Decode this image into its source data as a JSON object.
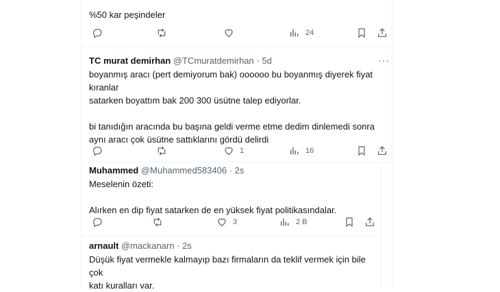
{
  "colors": {
    "text": "#0f1419",
    "muted": "#536471",
    "divider": "#eff3f4"
  },
  "tweets": [
    {
      "text": "%50 kar peşindeler",
      "actions": {
        "reply": "",
        "retweet": "",
        "like": "",
        "views": "24"
      }
    },
    {
      "name": "TC murat demirhan",
      "handle": "@TCmuratdemirhan",
      "sep": "·",
      "time": "5d",
      "more": "···",
      "text": "boyanmış aracı (pert demiyorum bak) oooooo bu boyanmış diyerek fiyat\nkıranlar\nsatarken boyattım bak 200 300 üsütne talep ediyorlar.\n\nbi tanıdığın aracında bu başına geldi verme etme dedim dinlemedi sonra\naynı aracı çok üsütne sattıklarını gördü delirdi",
      "actions": {
        "reply": "",
        "retweet": "",
        "like": "1",
        "views": "16"
      }
    },
    {
      "name": "Muhammed",
      "handle": "@Muhammed583406",
      "sep": "·",
      "time": "2s",
      "more": "···",
      "text": "Meselenin özeti:\n\nAlırken en dip fiyat satarken de en yüksek fiyat politikasındalar.",
      "actions": {
        "reply": "",
        "retweet": "",
        "like": "3",
        "views": "2 B"
      }
    },
    {
      "name": "arnault",
      "handle": "@mackanarn",
      "sep": "·",
      "time": "2s",
      "text": "Düşük fiyat vermekle kalmayıp bazı firmaların da teklif vermek için bile çok\nkatı kuralları var."
    }
  ],
  "icons": [
    "reply-icon",
    "retweet-icon",
    "like-icon",
    "views-icon",
    "bookmark-icon",
    "share-icon",
    "more-icon"
  ]
}
